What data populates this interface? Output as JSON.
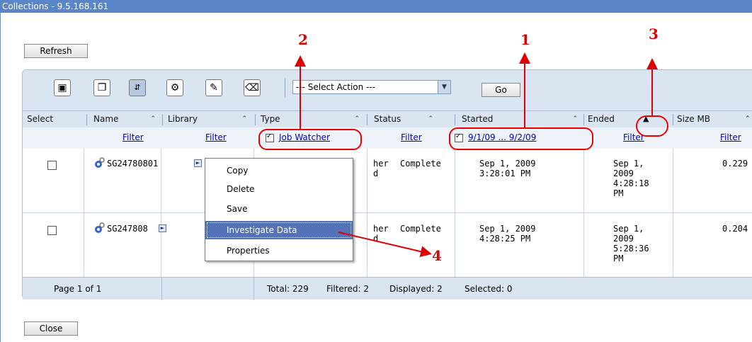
{
  "window": {
    "title": "Collections - 9.5.168.161"
  },
  "toolbar": {
    "refresh_label": "Refresh",
    "action_select_value": "--- Select Action ---",
    "go_label": "Go"
  },
  "table": {
    "columns": [
      {
        "key": "select",
        "label": "Select"
      },
      {
        "key": "name",
        "label": "Name"
      },
      {
        "key": "library",
        "label": "Library"
      },
      {
        "key": "type",
        "label": "Type"
      },
      {
        "key": "status",
        "label": "Status"
      },
      {
        "key": "started",
        "label": "Started"
      },
      {
        "key": "ended",
        "label": "Ended"
      },
      {
        "key": "size",
        "label": "Size MB"
      }
    ],
    "filters": {
      "name": "Filter",
      "library": "Filter",
      "type": "Job Watcher",
      "status": "Filter",
      "started": "9/1/09 ... 9/2/09",
      "ended": "Filter",
      "size": "Filter"
    },
    "rows": [
      {
        "name": "SG24780801",
        "type_partial": "her\nd",
        "status": "Complete",
        "started": "Sep 1, 2009\n3:28:01 PM",
        "ended": "Sep 1,\n2009\n4:28:18\nPM",
        "size": "0.229"
      },
      {
        "name": "SG247808",
        "type_partial": "her\nd",
        "status": "Complete",
        "started": "Sep 1, 2009\n4:28:25 PM",
        "ended": "Sep 1,\n2009\n5:28:36\nPM",
        "size": "0.204"
      }
    ],
    "footer": {
      "page": "Page 1 of 1",
      "total": "Total: 229",
      "filtered": "Filtered: 2",
      "displayed": "Displayed: 2",
      "selected": "Selected: 0"
    }
  },
  "context_menu": {
    "items": [
      "Copy",
      "Delete",
      "Save",
      "Investigate Data",
      "Properties"
    ],
    "highlighted": "Investigate Data"
  },
  "callouts": [
    "1",
    "2",
    "3",
    "4"
  ],
  "close_label": "Close",
  "colors": {
    "title_bar": "#5a85c8",
    "panel": "#dbe5f1",
    "menu_highlight": "#5372b8",
    "callout": "#dd0000"
  }
}
